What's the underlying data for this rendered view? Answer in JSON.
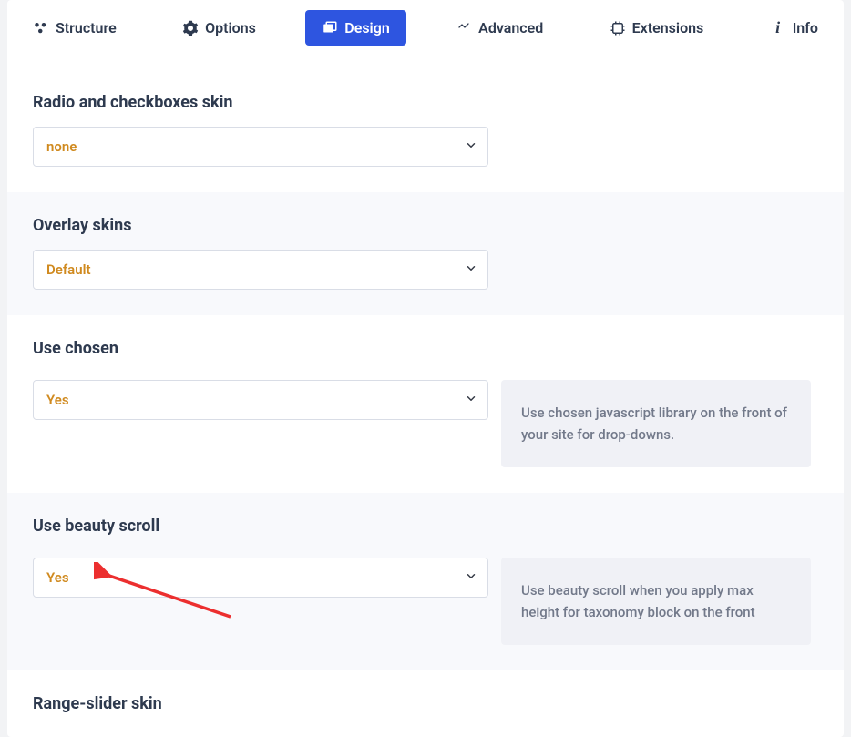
{
  "tabs": {
    "structure": "Structure",
    "options": "Options",
    "design": "Design",
    "advanced": "Advanced",
    "extensions": "Extensions",
    "info": "Info"
  },
  "fields": {
    "radioSkin": {
      "label": "Radio and checkboxes skin",
      "value": "none"
    },
    "overlaySkins": {
      "label": "Overlay skins",
      "value": "Default"
    },
    "useChosen": {
      "label": "Use chosen",
      "value": "Yes",
      "help": "Use chosen javascript library on the front of your site for drop-downs."
    },
    "useBeauty": {
      "label": "Use beauty scroll",
      "value": "Yes",
      "help": "Use beauty scroll when you apply max height for taxonomy block on the front"
    },
    "rangeSlider": {
      "label": "Range-slider skin"
    }
  }
}
